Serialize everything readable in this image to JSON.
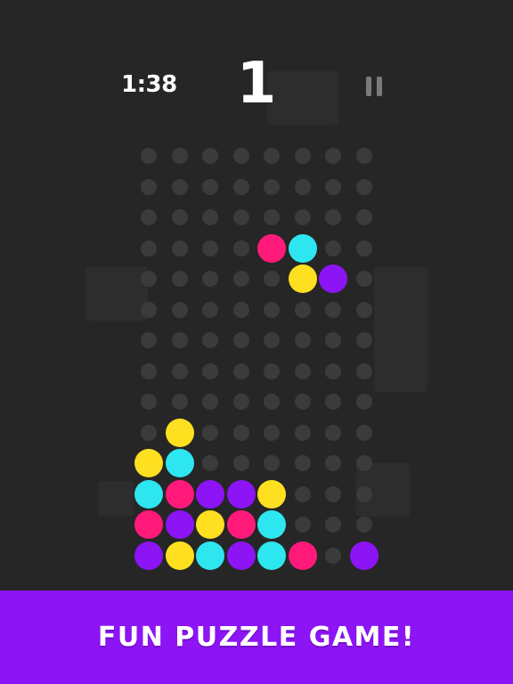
{
  "colors": {
    "background": "#262626",
    "empty_slot": "#3b3b3b",
    "magenta": "#ff1a7a",
    "cyan": "#2ee6f0",
    "yellow": "#ffe020",
    "purple": "#8c14f5",
    "banner": "#8c14f5"
  },
  "hud": {
    "timer": "1:38",
    "score": "1",
    "pause_icon": "pause-icon"
  },
  "board": {
    "cols": 8,
    "rows": 14,
    "falling_piece": [
      {
        "row": 3,
        "col": 4,
        "color": "magenta"
      },
      {
        "row": 3,
        "col": 5,
        "color": "cyan"
      },
      {
        "row": 4,
        "col": 5,
        "color": "yellow"
      },
      {
        "row": 4,
        "col": 6,
        "color": "purple"
      }
    ],
    "stack": [
      {
        "row": 9,
        "col": 1,
        "color": "yellow"
      },
      {
        "row": 10,
        "col": 0,
        "color": "yellow"
      },
      {
        "row": 10,
        "col": 1,
        "color": "cyan"
      },
      {
        "row": 11,
        "col": 0,
        "color": "cyan"
      },
      {
        "row": 11,
        "col": 1,
        "color": "magenta"
      },
      {
        "row": 11,
        "col": 2,
        "color": "purple"
      },
      {
        "row": 11,
        "col": 3,
        "color": "purple"
      },
      {
        "row": 11,
        "col": 4,
        "color": "yellow"
      },
      {
        "row": 12,
        "col": 0,
        "color": "magenta"
      },
      {
        "row": 12,
        "col": 1,
        "color": "purple"
      },
      {
        "row": 12,
        "col": 2,
        "color": "yellow"
      },
      {
        "row": 12,
        "col": 3,
        "color": "magenta"
      },
      {
        "row": 12,
        "col": 4,
        "color": "cyan"
      },
      {
        "row": 13,
        "col": 0,
        "color": "purple"
      },
      {
        "row": 13,
        "col": 1,
        "color": "yellow"
      },
      {
        "row": 13,
        "col": 2,
        "color": "cyan"
      },
      {
        "row": 13,
        "col": 3,
        "color": "purple"
      },
      {
        "row": 13,
        "col": 4,
        "color": "cyan"
      },
      {
        "row": 13,
        "col": 5,
        "color": "magenta"
      },
      {
        "row": 13,
        "col": 7,
        "color": "purple"
      }
    ]
  },
  "banner": {
    "text": "FUN PUZZLE GAME!"
  }
}
